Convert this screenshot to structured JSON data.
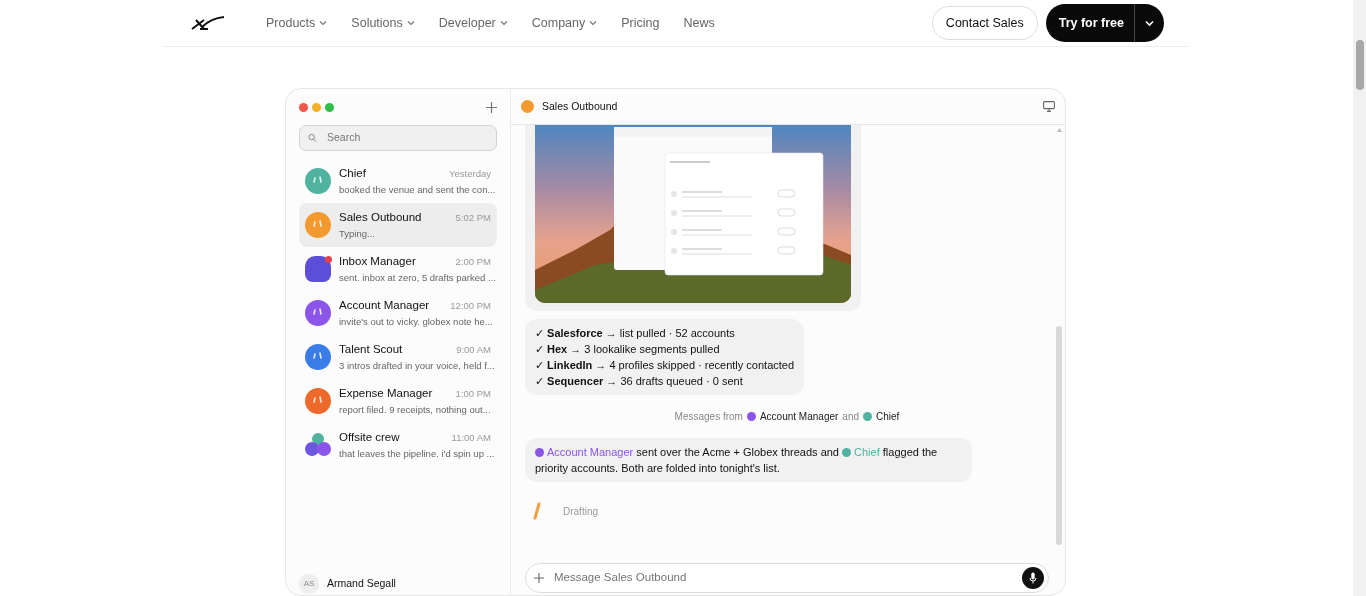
{
  "nav": {
    "links": [
      {
        "label": "Products",
        "dropdown": true
      },
      {
        "label": "Solutions",
        "dropdown": true
      },
      {
        "label": "Developer",
        "dropdown": true
      },
      {
        "label": "Company",
        "dropdown": true
      },
      {
        "label": "Pricing",
        "dropdown": false
      },
      {
        "label": "News",
        "dropdown": false
      }
    ],
    "contact_button": "Contact Sales",
    "try_button": "Try for free"
  },
  "sidebar": {
    "search": {
      "placeholder": "Search"
    },
    "conversations": [
      {
        "name": "Chief",
        "time": "Yesterday",
        "preview": "booked the venue and sent the con...",
        "color": "#4fb3a0",
        "kind": "single",
        "selected": false
      },
      {
        "name": "Sales Outbound",
        "time": "5:02 PM",
        "preview": "Typing...",
        "color": "#f29a30",
        "kind": "single",
        "selected": true
      },
      {
        "name": "Inbox Manager",
        "time": "2:00 PM",
        "preview": "sent. inbox at zero, 5 drafts parked ...",
        "color": "#5a4fd6",
        "kind": "badge",
        "selected": false
      },
      {
        "name": "Account Manager",
        "time": "12:00 PM",
        "preview": "invite's out to vicky. globex note he...",
        "color": "#8a55e8",
        "kind": "single",
        "selected": false
      },
      {
        "name": "Talent Scout",
        "time": "9:00 AM",
        "preview": "3 intros drafted in your voice, held f...",
        "color": "#3b7de8",
        "kind": "single",
        "selected": false
      },
      {
        "name": "Expense Manager",
        "time": "1:00 PM",
        "preview": "report filed. 9 receipts, nothing out...",
        "color": "#ee6a2c",
        "kind": "single",
        "selected": false
      },
      {
        "name": "Offsite crew",
        "time": "11:00 AM",
        "preview": "that leaves the pipeline. i'd spin up ...",
        "color": "#6b57e0",
        "kind": "group",
        "selected": false
      }
    ],
    "user": {
      "initials": "AS",
      "name": "Armand Segall"
    }
  },
  "chat": {
    "title": "Sales Outbound",
    "color": "#f29a30",
    "steps": [
      "✓ **Salesforce** → list pulled · 52 accounts",
      "✓ **Hex** → 3 lookalike segments pulled",
      "✓ **LinkedIn** → 4 profiles skipped · recently contacted",
      "✓ **Sequencer** → 36 drafts queued · 0 sent"
    ],
    "handoff": {
      "prefix": "Messages from",
      "joiner": "and",
      "agents": [
        {
          "name": "Account Manager",
          "color": "#8a55e8"
        },
        {
          "name": "Chief",
          "color": "#4fb3a0"
        }
      ]
    },
    "summary": [
      {
        "kind": "mention",
        "text": "Account Manager",
        "color": "#8a55e8"
      },
      {
        "kind": "text",
        "text": " sent over the Acme + Globex threads and "
      },
      {
        "kind": "mention",
        "text": "Chief",
        "color": "#4fb3a0"
      },
      {
        "kind": "text",
        "text": " flagged the priority accounts. Both are folded into tonight's list."
      }
    ],
    "status": "Drafting",
    "composer": {
      "placeholder": "Message Sales Outbound"
    }
  }
}
